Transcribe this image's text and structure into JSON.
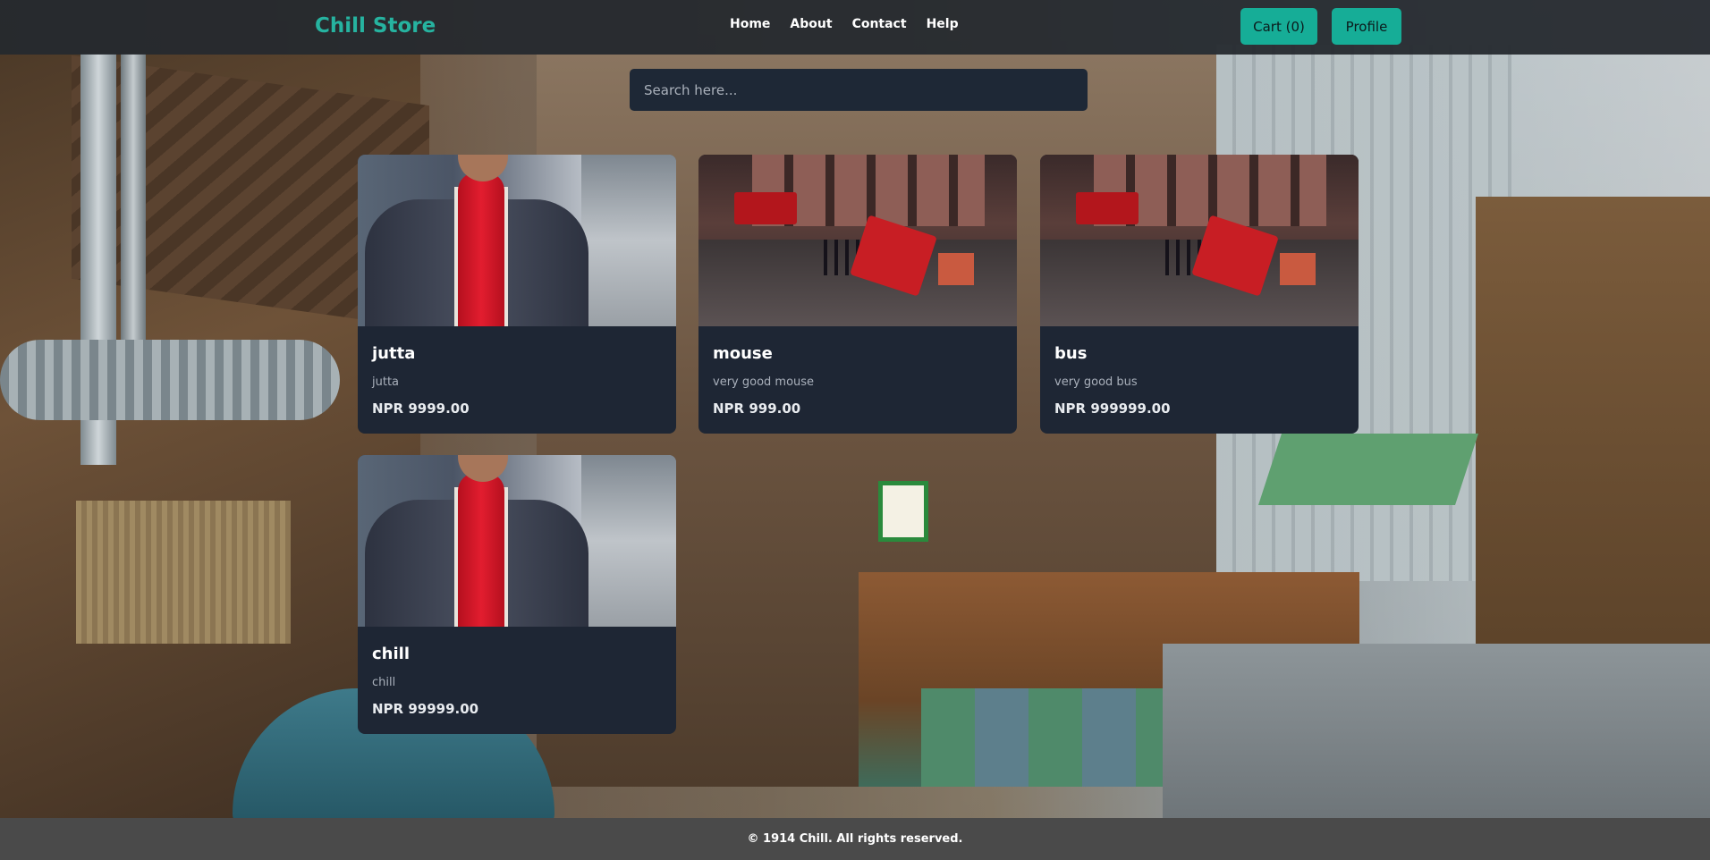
{
  "header": {
    "brand": "Chill Store",
    "nav": [
      "Home",
      "About",
      "Contact",
      "Help"
    ],
    "cart_label": "Cart (0)",
    "profile_label": "Profile"
  },
  "search": {
    "placeholder": "Search here..."
  },
  "products": [
    {
      "title": "jutta",
      "description": "jutta",
      "price": "NPR 9999.00",
      "image": "man-in-blazer-red-scarf-photo"
    },
    {
      "title": "mouse",
      "description": "very good mouse",
      "price": "NPR 999.00",
      "image": "london-street-buses-photo"
    },
    {
      "title": "bus",
      "description": "very good bus",
      "price": "NPR 999999.00",
      "image": "london-street-buses-photo"
    },
    {
      "title": "chill",
      "description": "chill",
      "price": "NPR 99999.00",
      "image": "man-in-blazer-red-scarf-photo"
    }
  ],
  "footer": {
    "text": "© 1914 Chill. All rights reserved."
  },
  "colors": {
    "brand": "#26b3a0",
    "button": "#16ad97",
    "navbar": "#24282e",
    "card": "#1e2634",
    "footer": "#4a4a4a"
  }
}
